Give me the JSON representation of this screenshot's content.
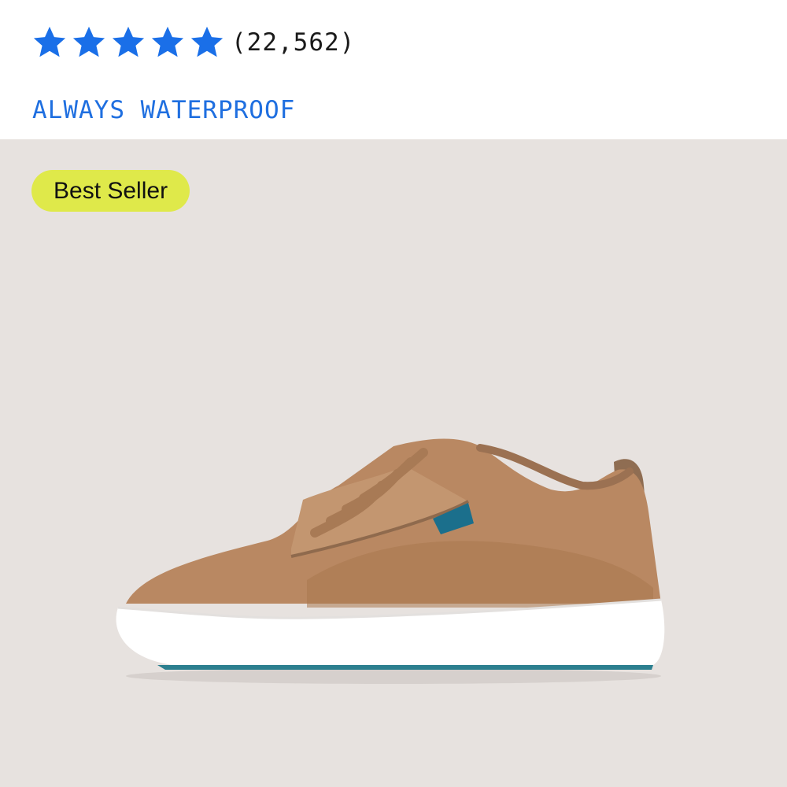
{
  "product_card": {
    "rating": {
      "stars": 5,
      "star_color": "#1a6fe8",
      "review_count": "(22,562)"
    },
    "tagline": "ALWAYS WATERPROOF",
    "tagline_color": "#1f6fe0",
    "image": {
      "badge": "Best Seller",
      "badge_color": "#dfe94a",
      "background_color": "#e7e2df",
      "subject": "shoe-product-image"
    }
  }
}
